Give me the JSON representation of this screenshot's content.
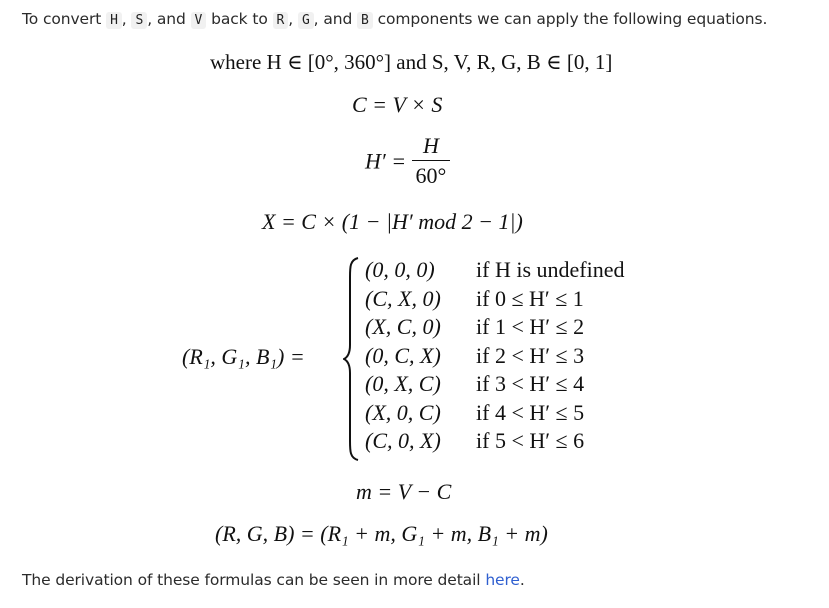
{
  "intro": {
    "before": "To convert ",
    "codes": [
      "H",
      "S",
      "V",
      "R",
      "G",
      "B"
    ],
    "sep1": ", ",
    "sep2": ", and ",
    "mid": " back to ",
    "after": " components we can apply the following equations."
  },
  "equations": {
    "domain": "where H ∈ [0°, 360°] and S, V, R, G, B ∈ [0, 1]",
    "chroma": "C = V × S",
    "hprime_lhs": "H′ =",
    "hprime_num": "H",
    "hprime_den": "60°",
    "x_eq": "X = C × (1 − |H′ mod 2 − 1|)",
    "rgb1_lhs": "(R₁, G₁, B₁) =",
    "cases": [
      {
        "value": "(0, 0, 0)",
        "condition": "if H is undefined"
      },
      {
        "value": "(C, X, 0)",
        "condition": "if 0 ≤ H′ ≤ 1"
      },
      {
        "value": "(X, C, 0)",
        "condition": "if 1 < H′ ≤ 2"
      },
      {
        "value": "(0, C, X)",
        "condition": "if 2 < H′ ≤ 3"
      },
      {
        "value": "(0, X, C)",
        "condition": "if 3 < H′ ≤ 4"
      },
      {
        "value": "(X, 0, C)",
        "condition": "if 4 < H′ ≤ 5"
      },
      {
        "value": "(C, 0, X)",
        "condition": "if 5 < H′ ≤ 6"
      }
    ],
    "m_eq": "m = V − C",
    "rgb_eq": "(R, G, B) = (R₁ + m, G₁ + m, B₁ + m)"
  },
  "footer": {
    "text": "The derivation of these formulas can be seen in more detail ",
    "link_label": "here",
    "end": "."
  },
  "colors": {
    "link": "#2f5fd0",
    "code_bg": "#f1f1f1"
  }
}
